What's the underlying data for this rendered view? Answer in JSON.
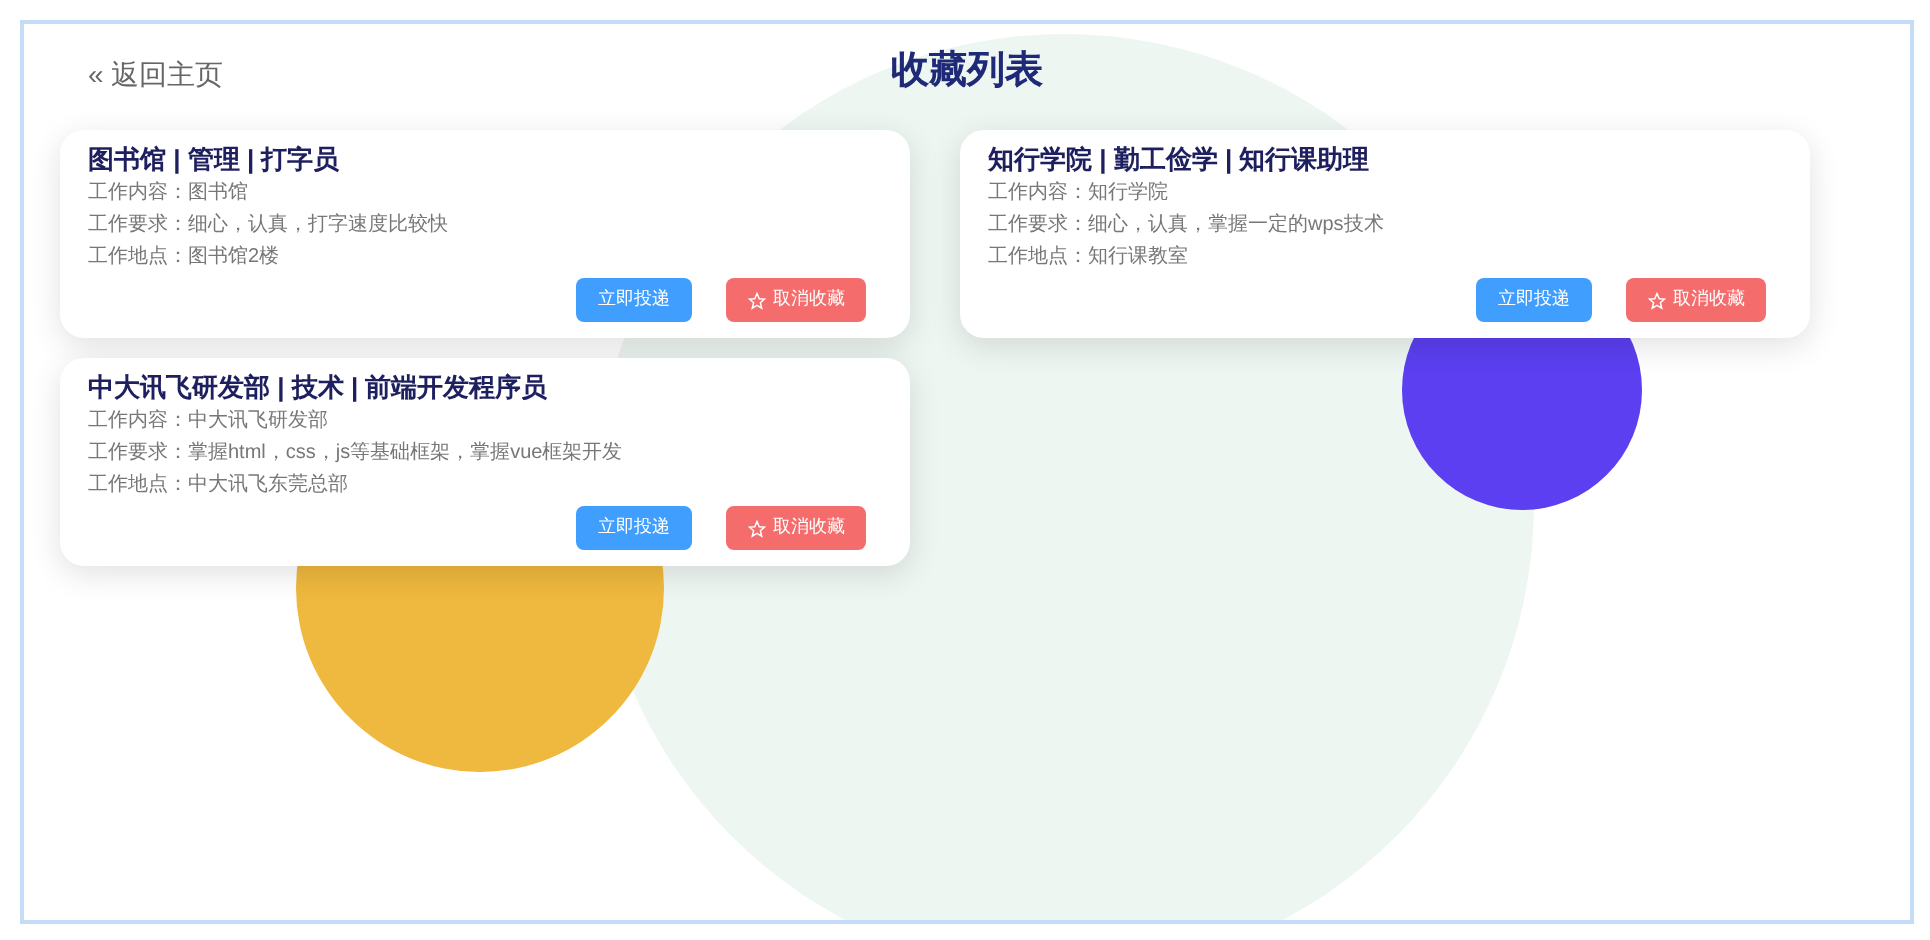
{
  "header": {
    "back_link": "« 返回主页",
    "title": "收藏列表"
  },
  "cards": [
    {
      "title": "图书馆 | 管理 | 打字员",
      "lines": [
        "工作内容：图书馆",
        "工作要求：细心，认真，打字速度比较快",
        "工作地点：图书馆2楼"
      ],
      "apply_button": "立即投递",
      "unfavorite_button": "取消收藏"
    },
    {
      "title": "知行学院 | 勤工俭学 | 知行课助理",
      "lines": [
        "工作内容：知行学院",
        "工作要求：细心，认真，掌握一定的wps技术",
        "工作地点：知行课教室"
      ],
      "apply_button": "立即投递",
      "unfavorite_button": "取消收藏"
    },
    {
      "title": "中大讯飞研发部 | 技术 | 前端开发程序员",
      "lines": [
        "工作内容：中大讯飞研发部",
        "工作要求：掌握html，css，js等基础框架，掌握vue框架开发",
        "工作地点：中大讯飞东莞总部"
      ],
      "apply_button": "立即投递",
      "unfavorite_button": "取消收藏"
    }
  ]
}
